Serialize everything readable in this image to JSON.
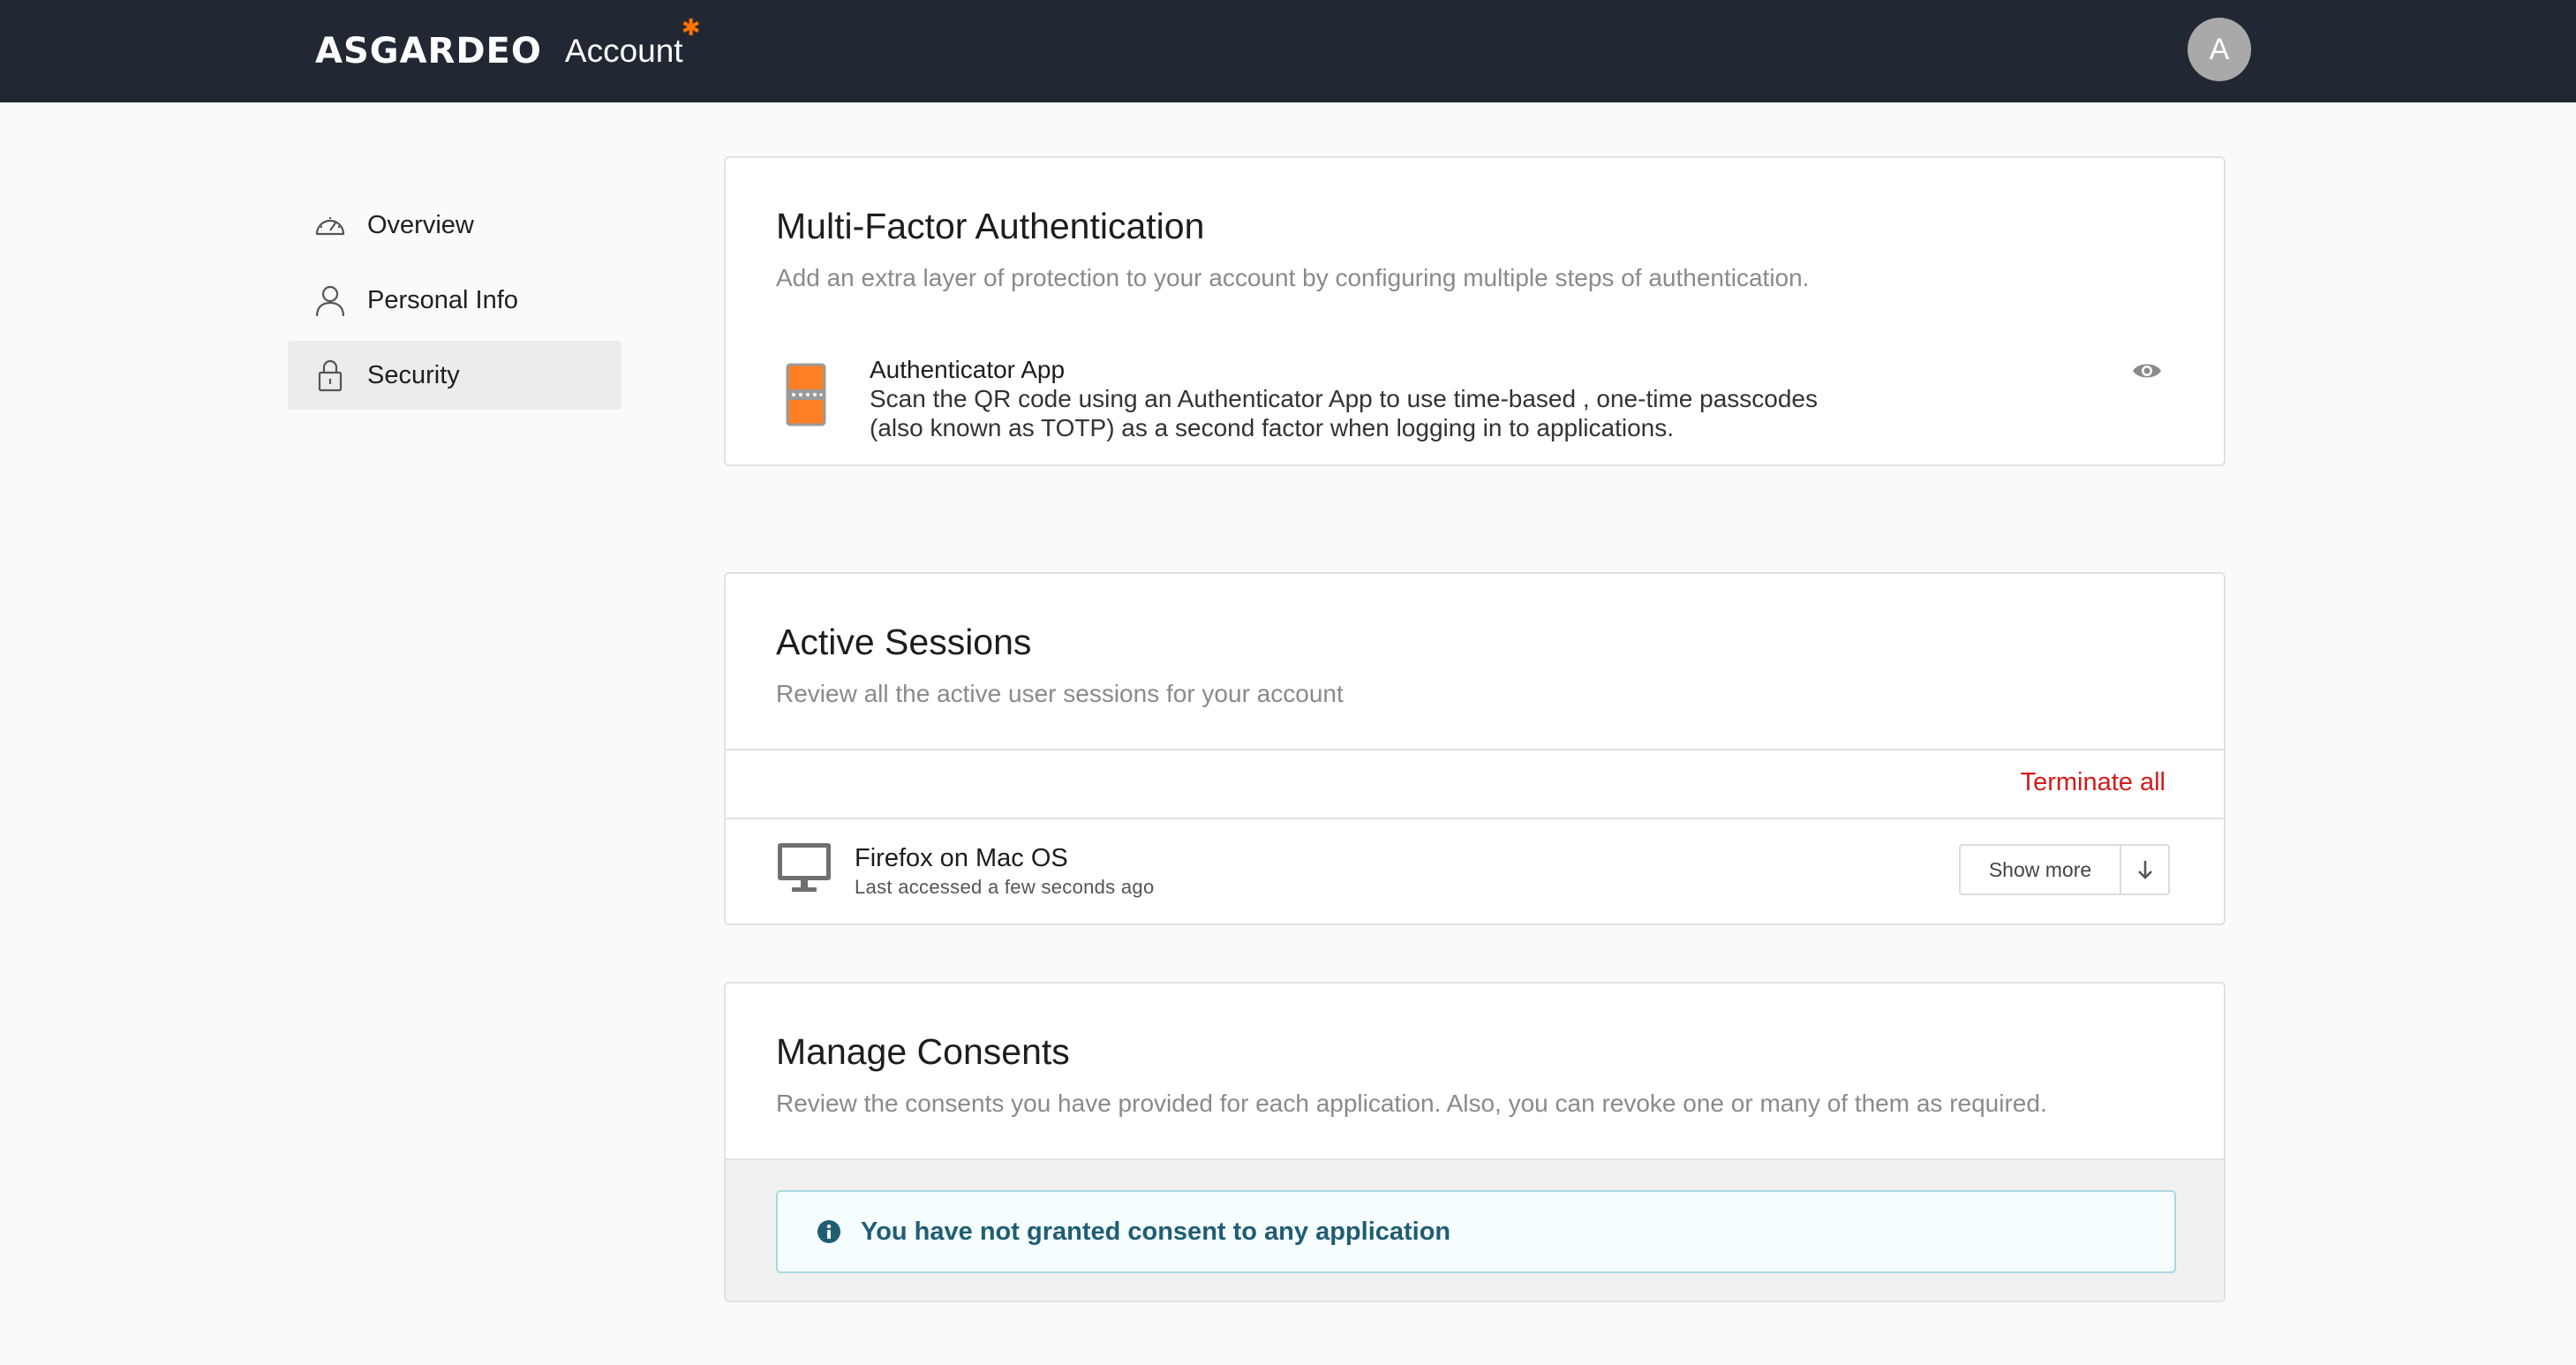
{
  "header": {
    "brand": "ASGARDEO",
    "brand_suffix": "Account",
    "avatar_letter": "A"
  },
  "sidebar": {
    "items": [
      {
        "label": "Overview",
        "icon": "speedometer-icon",
        "active": false
      },
      {
        "label": "Personal Info",
        "icon": "user-icon",
        "active": false
      },
      {
        "label": "Security",
        "icon": "lock-icon",
        "active": true
      }
    ]
  },
  "mfa": {
    "title": "Multi-Factor Authentication",
    "subtitle": "Add an extra layer of protection to your account by configuring multiple steps of authentication.",
    "authenticator": {
      "name": "Authenticator App",
      "description_line1": "Scan the QR code using an Authenticator App to use time-based , one-time passcodes",
      "description_line2": "(also known as TOTP) as a second factor when logging in to applications."
    }
  },
  "sessions": {
    "title": "Active Sessions",
    "subtitle": "Review all the active user sessions for your account",
    "terminate_all_label": "Terminate all",
    "items": [
      {
        "name": "Firefox on Mac OS",
        "last_accessed": "Last accessed a few seconds ago",
        "show_more_label": "Show more"
      }
    ]
  },
  "consents": {
    "title": "Manage Consents",
    "subtitle": "Review the consents you have provided for each application. Also, you can revoke one or many of them as required.",
    "empty_message": "You have not granted consent to any application"
  },
  "colors": {
    "topbar": "#222833",
    "brand_accent": "#ff7300",
    "danger": "#d41a1a",
    "info_text": "#1f5d73"
  }
}
